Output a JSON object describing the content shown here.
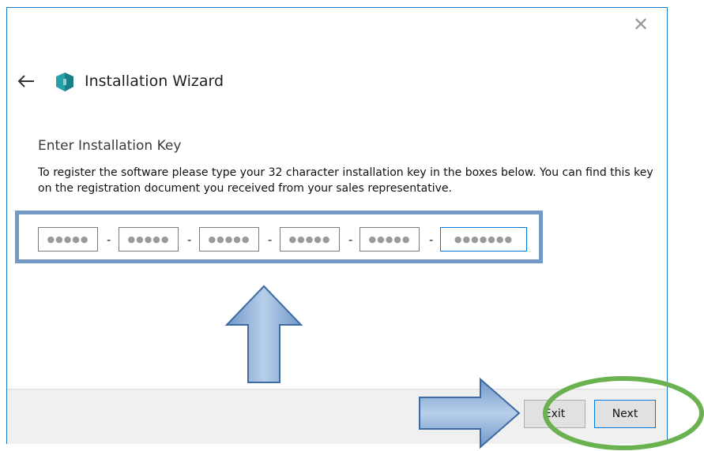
{
  "window": {
    "title": "Installation Wizard",
    "close_glyph": "✕",
    "back_icon": "arrow-left-icon",
    "app_icon": "shield-icon"
  },
  "content": {
    "heading": "Enter Installation Key",
    "description": "To register the software please type your 32 character installation key in the boxes below. You can find this key on the registration document you received from your sales representative.",
    "separator": "-",
    "key_fields": [
      {
        "value": "●●●●●"
      },
      {
        "value": "●●●●●"
      },
      {
        "value": "●●●●●"
      },
      {
        "value": "●●●●●"
      },
      {
        "value": "●●●●●"
      },
      {
        "value": "●●●●●●●"
      }
    ]
  },
  "footer": {
    "exit_label": "Exit",
    "next_label": "Next"
  },
  "colors": {
    "window_border": "#1979ca",
    "highlight_border": "#7399c6",
    "annotation_arrow": "#8fb2d9",
    "annotation_ellipse": "#6ab150"
  }
}
